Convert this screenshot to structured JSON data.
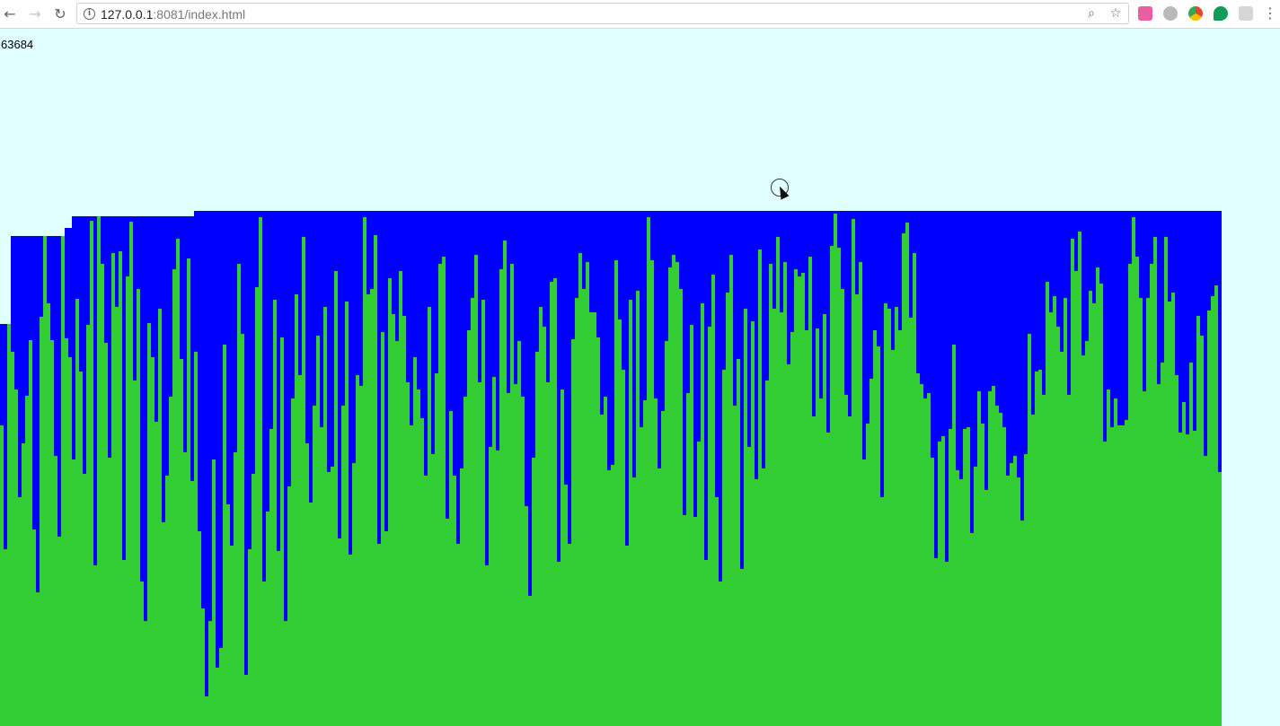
{
  "browser": {
    "url_host": "127.0.0.1",
    "url_rest": ":8081/index.html",
    "icons": {
      "back": "back-arrow-icon",
      "forward": "forward-arrow-icon",
      "reload": "reload-icon",
      "info": "info-icon",
      "zoom": "zoom-icon",
      "bookmark": "star-icon",
      "menu": "kebab-menu-icon"
    },
    "extensions": [
      {
        "name": "ext-pink-icon",
        "color": "#e85ea0"
      },
      {
        "name": "ext-grey-icon",
        "color": "#b9b9b9"
      },
      {
        "name": "ext-chrome-icon",
        "color": "#4285f4"
      },
      {
        "name": "ext-green-chat-icon",
        "color": "#0f9d58"
      },
      {
        "name": "ext-grid-icon",
        "color": "#c9c9c9"
      }
    ]
  },
  "page": {
    "counter_text": "63684",
    "background": "#e0ffff"
  },
  "chart_data": {
    "type": "bar",
    "colors": {
      "background_bar": "#0000ff",
      "value_bar": "#32cd32"
    },
    "bar_width": 4,
    "baseline": 777,
    "background_tops": [
      329,
      329,
      329,
      231,
      231,
      231,
      231,
      231,
      231,
      231,
      231,
      231,
      231,
      231,
      231,
      231,
      231,
      231,
      222,
      222,
      209,
      209,
      209,
      209,
      209,
      209,
      209,
      209,
      209,
      209,
      209,
      209,
      209,
      209,
      209,
      209,
      209,
      209,
      209,
      209,
      209,
      209,
      209,
      209,
      209,
      209,
      209,
      209,
      209,
      209,
      209,
      209,
      209,
      209,
      203,
      203,
      203,
      203,
      203,
      203,
      203,
      203,
      203,
      203,
      203,
      203,
      203,
      203,
      203,
      203,
      203,
      203,
      203,
      203,
      203,
      203,
      203,
      203,
      203,
      203,
      203,
      203,
      203,
      203,
      203,
      203,
      203,
      203,
      203,
      203,
      203,
      203,
      203,
      203,
      203,
      203,
      203,
      203,
      203,
      203,
      203,
      203,
      203,
      203,
      203,
      203,
      203,
      203,
      203,
      203,
      203,
      203,
      203,
      203,
      203,
      203,
      203,
      203,
      203,
      203,
      203,
      203,
      203,
      203,
      203,
      203,
      203,
      203,
      203,
      203,
      203,
      203,
      203,
      203,
      203,
      203,
      203,
      203,
      203,
      203,
      203,
      203,
      203,
      203,
      203,
      203,
      203,
      203,
      203,
      203,
      203,
      203,
      203,
      203,
      203,
      203,
      203,
      203,
      203,
      203,
      203,
      203,
      203,
      203,
      203,
      203,
      203,
      203,
      203,
      203,
      203,
      203,
      203,
      203,
      203,
      203,
      203,
      203,
      203,
      203,
      203,
      203,
      203,
      203,
      203,
      203,
      203,
      203,
      203,
      203,
      203,
      203,
      203,
      203,
      203,
      203,
      203,
      203,
      203,
      203,
      203,
      203,
      203,
      203,
      203,
      203,
      203,
      203,
      203,
      203,
      203,
      203,
      203,
      203,
      203,
      203,
      203,
      203,
      203,
      203,
      203,
      203,
      203,
      203,
      203,
      203,
      203,
      203,
      203,
      203,
      203,
      203,
      203,
      203,
      203,
      203,
      203,
      203,
      203,
      203,
      203,
      203,
      203,
      203,
      203,
      203,
      203,
      203,
      203,
      203,
      203,
      203,
      203,
      203,
      203,
      203,
      203,
      203,
      203,
      203,
      203,
      203,
      203,
      203,
      203,
      203,
      203,
      203,
      203,
      203,
      203,
      203,
      203,
      203,
      203,
      203,
      203,
      203,
      203,
      203,
      203,
      203,
      203,
      203,
      203,
      203,
      203,
      203,
      203,
      203,
      203,
      203,
      203,
      203,
      203,
      203,
      203,
      203,
      203,
      203,
      203,
      203,
      203,
      203,
      203,
      203,
      203,
      203,
      203,
      203,
      203,
      203,
      203,
      203,
      203,
      203,
      203,
      203,
      203,
      203,
      203,
      203,
      203,
      203,
      203,
      203,
      203,
      203,
      203,
      203,
      203,
      203,
      203,
      203,
      203,
      203,
      203,
      203,
      203,
      203
    ],
    "values": [
      442,
      580,
      232,
      360,
      402,
      522,
      462,
      409,
      347,
      558,
      628,
      321,
      218,
      306,
      347,
      476,
      566,
      208,
      345,
      366,
      480,
      301,
      382,
      496,
      330,
      214,
      598,
      208,
      262,
      350,
      478,
      250,
      310,
      248,
      592,
      276,
      215,
      392,
      290,
      616,
      660,
      328,
      366,
      438,
      312,
      550,
      498,
      410,
      268,
      234,
      368,
      472,
      256,
      504,
      360,
      560,
      646,
      744,
      660,
      480,
      712,
      690,
      352,
      530,
      576,
      472,
      262,
      340,
      720,
      580,
      496,
      288,
      210,
      616,
      538,
      446,
      302,
      582,
      344,
      660,
      510,
      412,
      296,
      386,
      232,
      462,
      528,
      420,
      342,
      444,
      310,
      494,
      488,
      270,
      568,
      420,
      304,
      586,
      484,
      386,
      398,
      210,
      296,
      290,
      230,
      574,
      338,
      560,
      278,
      318,
      348,
      270,
      320,
      394,
      442,
      366,
      402,
      434,
      498,
      310,
      474,
      384,
      262,
      254,
      546,
      426,
      498,
      574,
      490,
      410,
      336,
      300,
      252,
      394,
      302,
      598,
      466,
      388,
      470,
      268,
      236,
      406,
      262,
      396,
      348,
      410,
      532,
      632,
      478,
      360,
      310,
      332,
      394,
      282,
      278,
      594,
      402,
      508,
      574,
      346,
      300,
      250,
      290,
      260,
      316,
      316,
      344,
      430,
      410,
      492,
      486,
      258,
      324,
      380,
      576,
      302,
      500,
      292,
      444,
      414,
      210,
      258,
      412,
      490,
      426,
      348,
      266,
      252,
      260,
      290,
      542,
      406,
      330,
      544,
      460,
      306,
      592,
      332,
      274,
      522,
      616,
      380,
      294,
      252,
      420,
      368,
      602,
      312,
      466,
      326,
      502,
      246,
      490,
      392,
      262,
      312,
      232,
      316,
      260,
      374,
      338,
      268,
      276,
      272,
      336,
      254,
      432,
      334,
      412,
      318,
      450,
      242,
      206,
      244,
      290,
      408,
      432,
      212,
      296,
      260,
      480,
      440,
      390,
      336,
      354,
      522,
      306,
      312,
      358,
      310,
      336,
      228,
      216,
      322,
      250,
      384,
      396,
      412,
      406,
      478,
      590,
      460,
      454,
      594,
      446,
      352,
      492,
      502,
      446,
      444,
      562,
      488,
      404,
      440,
      514,
      404,
      398,
      420,
      428,
      444,
      498,
      484,
      476,
      500,
      548,
      474,
      340,
      430,
      382,
      380,
      408,
      282,
      316,
      298,
      332,
      360,
      300,
      408,
      234,
      270,
      226,
      364,
      348,
      292,
      306,
      266,
      284,
      460,
      402,
      444,
      412,
      442,
      442,
      436,
      262,
      210,
      254,
      300,
      404,
      300,
      262,
      232,
      396,
      372,
      232,
      304,
      294,
      386,
      450,
      416,
      452,
      372,
      448,
      320,
      342,
      476,
      314,
      298,
      286,
      494
    ]
  }
}
